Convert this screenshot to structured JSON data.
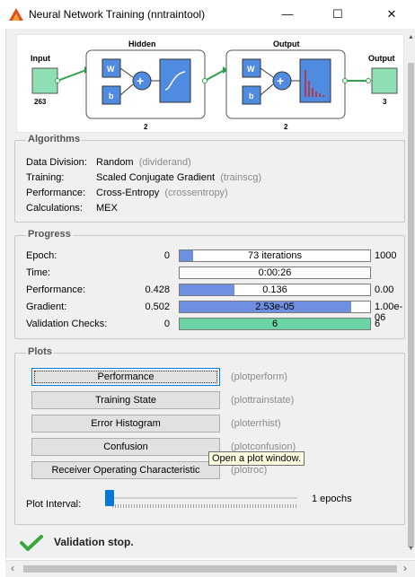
{
  "window": {
    "title": "Neural Network Training (nntraintool)",
    "minimize": "—",
    "maximize": "☐",
    "close": "✕"
  },
  "diagram": {
    "input_label": "Input",
    "input_size": "263",
    "hidden_label": "Hidden",
    "hidden_size": "2",
    "output_layer_label": "Output",
    "output_layer_size": "2",
    "output_label": "Output",
    "output_size": "3",
    "weight": "W",
    "bias": "b",
    "plus": "+"
  },
  "algorithms": {
    "section_title": "Algorithms",
    "rows": [
      {
        "label": "Data Division:",
        "value": "Random",
        "fn": "(dividerand)"
      },
      {
        "label": "Training:",
        "value": "Scaled Conjugate Gradient",
        "fn": "(trainscg)"
      },
      {
        "label": "Performance:",
        "value": "Cross-Entropy",
        "fn": "(crossentropy)"
      },
      {
        "label": "Calculations:",
        "value": "MEX",
        "fn": ""
      }
    ]
  },
  "progress": {
    "section_title": "Progress",
    "rows": [
      {
        "label": "Epoch:",
        "min": "0",
        "text": "73 iterations",
        "max": "1000",
        "fill": 0.073,
        "color": "#6f8fe0"
      },
      {
        "label": "Time:",
        "min": "",
        "text": "0:00:26",
        "max": "",
        "fill": 0,
        "color": "#6f8fe0"
      },
      {
        "label": "Performance:",
        "min": "0.428",
        "text": "0.136",
        "max": "0.00",
        "fill": 0.29,
        "color": "#6f8fe0"
      },
      {
        "label": "Gradient:",
        "min": "0.502",
        "text": "2.53e-05",
        "max": "1.00e-06",
        "fill": 0.9,
        "color": "#6f8fe0"
      },
      {
        "label": "Validation Checks:",
        "min": "0",
        "text": "6",
        "max": "6",
        "fill": 1.0,
        "color": "#6cd4a4"
      }
    ]
  },
  "plots": {
    "section_title": "Plots",
    "buttons": [
      {
        "label": "Performance",
        "fn": "(plotperform)"
      },
      {
        "label": "Training State",
        "fn": "(plottrainstate)"
      },
      {
        "label": "Error Histogram",
        "fn": "(ploterrhist)"
      },
      {
        "label": "Confusion",
        "fn": "(plotconfusion)"
      },
      {
        "label": "Receiver Operating Characteristic",
        "fn": "(plotroc)"
      }
    ],
    "tooltip": "Open a plot window.",
    "interval_label": "Plot Interval:",
    "interval_value": "1 epochs",
    "interval_level": 0.0
  },
  "status": {
    "text": "Validation stop."
  },
  "colors": {
    "box_green": "#8ee0b4",
    "box_blue": "#4f8be0",
    "layer_border": "#2fa04a",
    "check_green": "#3aa63a"
  }
}
